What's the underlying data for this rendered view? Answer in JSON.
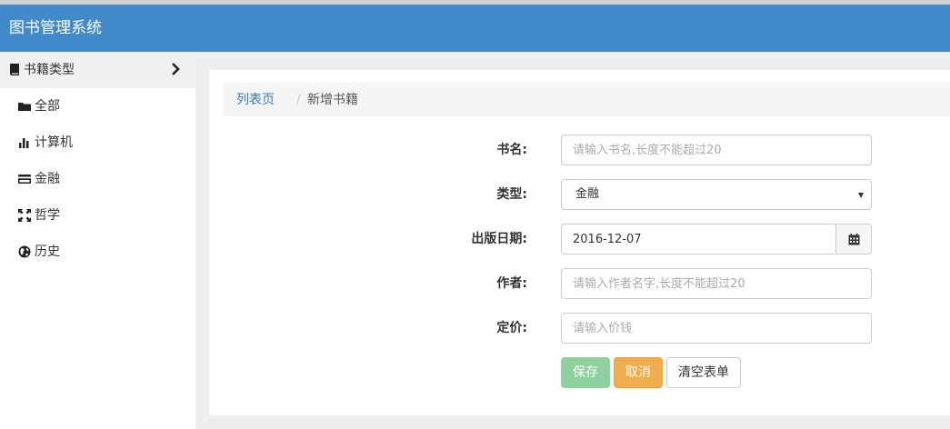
{
  "app": {
    "title": "图书管理系统"
  },
  "sidebar": {
    "header": {
      "label": "书籍类型",
      "icon": "book-icon"
    },
    "items": [
      {
        "label": "全部",
        "icon": "folder-icon"
      },
      {
        "label": "计算机",
        "icon": "bar-chart-icon"
      },
      {
        "label": "金融",
        "icon": "credit-card-icon"
      },
      {
        "label": "哲学",
        "icon": "fullscreen-icon"
      },
      {
        "label": "历史",
        "icon": "globe-icon"
      }
    ]
  },
  "breadcrumb": {
    "link": "列表页",
    "separator": "/",
    "current": "新增书籍"
  },
  "form": {
    "name": {
      "label": "书名:",
      "placeholder": "请输入书名,长度不能超过20"
    },
    "type": {
      "label": "类型:",
      "value": "金融"
    },
    "date": {
      "label": "出版日期:",
      "value": "2016-12-07"
    },
    "author": {
      "label": "作者:",
      "placeholder": "请输入作者名字,长度不能超过20"
    },
    "price": {
      "label": "定价:",
      "placeholder": "请输入价钱"
    }
  },
  "buttons": {
    "save": "保存",
    "cancel": "取消",
    "clear": "清空表单"
  },
  "colors": {
    "topbar": "#428bca",
    "save": "#8fd19e",
    "cancel": "#f0ad4e",
    "link": "#337ab7"
  }
}
